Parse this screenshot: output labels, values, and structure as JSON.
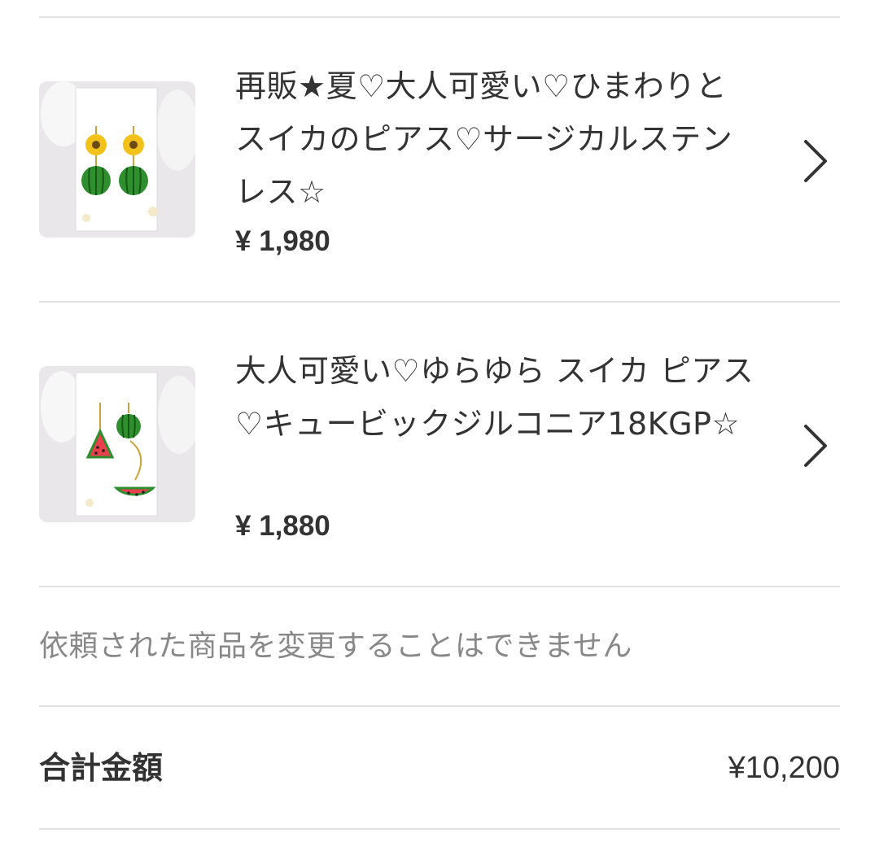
{
  "items": [
    {
      "title": "再販★夏♡大人可愛い♡ひまわりとスイカのピアス♡サージカルステンレス☆",
      "price": "¥ 1,980",
      "image_icon": "sunflower-watermelon-earrings-image"
    },
    {
      "title": "大人可愛い♡ゆらゆら スイカ ピアス♡キュービックジルコニア18KGP☆",
      "price": "¥ 1,880",
      "image_icon": "watermelon-slice-earrings-image"
    }
  ],
  "notice": "依頼された商品を変更することはできません",
  "total": {
    "label": "合計金額",
    "value": "¥10,200"
  },
  "colors": {
    "text": "#333333",
    "muted": "#888888",
    "divider": "#e2e2e2",
    "watermelon_green": "#2f8f2f",
    "sunflower_yellow": "#f2c21a",
    "watermelon_red": "#e8414d"
  }
}
